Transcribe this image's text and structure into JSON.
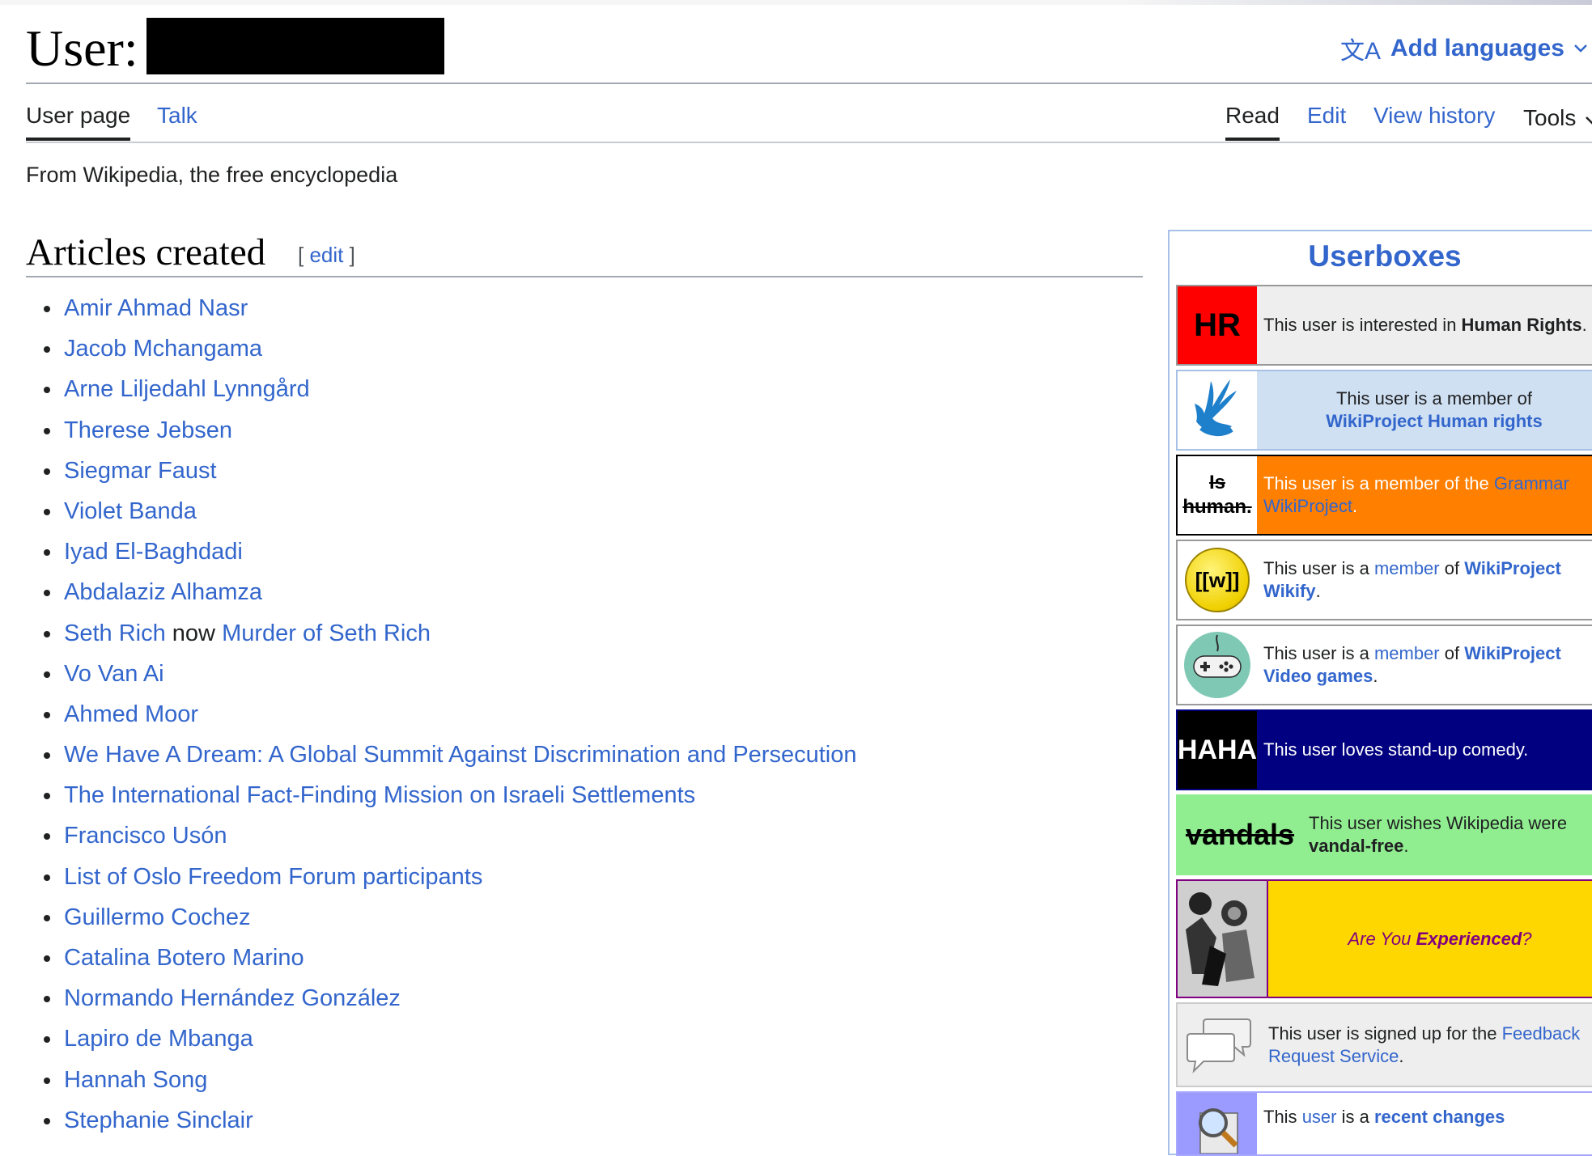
{
  "page": {
    "title_prefix": "User:",
    "add_languages": "Add languages",
    "lang_icon": "文A"
  },
  "tabs": {
    "left": [
      "User page",
      "Talk"
    ],
    "right": [
      "Read",
      "Edit",
      "View history",
      "Tools"
    ],
    "selected_left": "User page",
    "selected_right": "Read"
  },
  "tagline": "From Wikipedia, the free encyclopedia",
  "section": {
    "heading": "Articles created",
    "edit_open": "[ ",
    "edit_label": "edit",
    "edit_close": " ]"
  },
  "articles": [
    "Amir Ahmad Nasr",
    "Jacob Mchangama",
    "Arne Liljedahl Lynngård",
    "Therese Jebsen",
    "Siegmar Faust",
    "Violet Banda",
    "Iyad El-Baghdadi",
    "Abdalaziz Alhamza",
    "Seth Rich",
    "Vo Van Ai",
    "Ahmed Moor",
    "We Have A Dream: A Global Summit Against Discrimination and Persecution",
    "The International Fact-Finding Mission on Israeli Settlements",
    "Francisco Usón",
    "List of Oslo Freedom Forum participants",
    "Guillermo Cochez",
    "Catalina Botero Marino",
    "Normando Hernández González",
    "Lapiro de Mbanga",
    "Hannah Song",
    "Stephanie Sinclair"
  ],
  "seth_rich_extra": {
    "now": " now ",
    "link": "Murder of Seth Rich"
  },
  "userboxes_title": "Userboxes",
  "userboxes": {
    "hr": {
      "icon_text": "HR",
      "t1": "This user is interested in ",
      "b1": "Human Rights",
      "t2": "."
    },
    "hrp": {
      "t1": "This user is a member of",
      "l1": "WikiProject Human rights"
    },
    "grammar": {
      "icon_line1": "Is",
      "icon_line2": "human.",
      "t1": "This user is a member of the ",
      "l1": "Grammar WikiProject",
      "t2": "."
    },
    "wikify": {
      "icon_text": "[[w]]",
      "t1": "This user is a ",
      "l1": "member",
      "t2": " of ",
      "l2": "WikiProject Wikify",
      "t3": "."
    },
    "videogames": {
      "t1": "This user is a ",
      "l1": "member",
      "t2": " of ",
      "l2": "WikiProject Video games",
      "t3": "."
    },
    "haha": {
      "icon_text": "HAHA",
      "t1": "This user loves stand-up comedy."
    },
    "vandals": {
      "icon_text": "vandals",
      "t1": "This user wishes Wikipedia were ",
      "b1": "vandal-free",
      "t2": "."
    },
    "experienced": {
      "t1": "Are You ",
      "b1": "Experienced",
      "t2": "?"
    },
    "feedback": {
      "t1": "This user is signed up for the ",
      "l1": "Feedback Request Service",
      "t2": "."
    },
    "rc": {
      "t1": "This ",
      "l1": "user",
      "t2": " is a ",
      "l2": "recent changes"
    }
  },
  "colors": {
    "link": "#3366cc",
    "hr_red": "#ff0000",
    "grammar_orange": "#ff7f00",
    "haha_navy": "#000080",
    "vandals_green": "#90ee90",
    "experienced_yellow": "#ffd700"
  }
}
